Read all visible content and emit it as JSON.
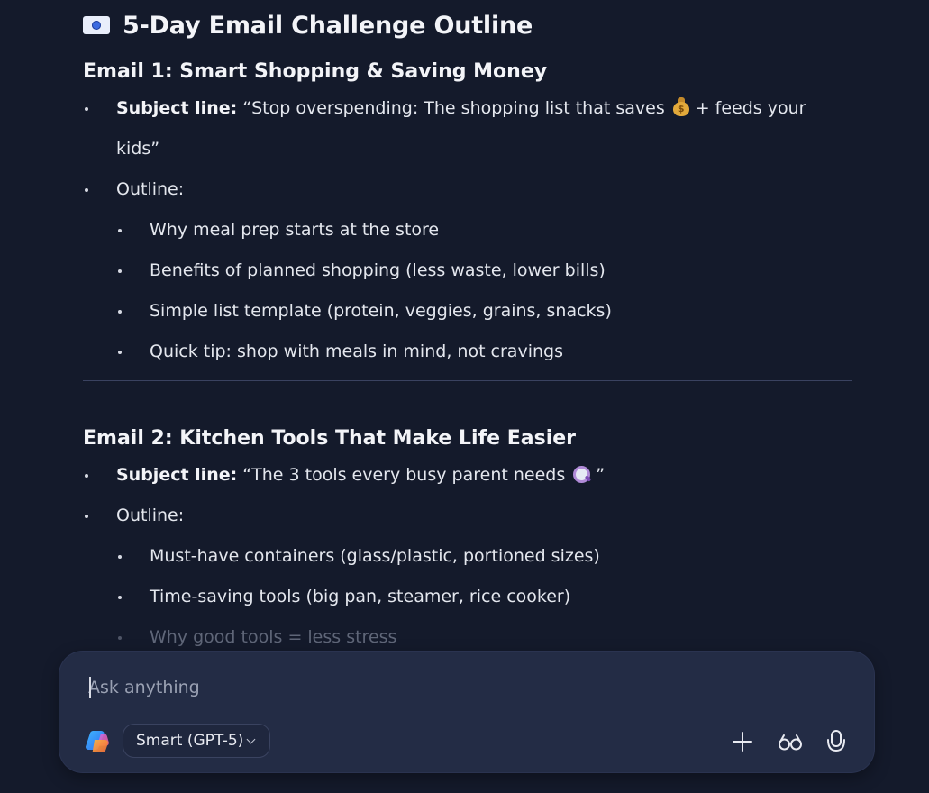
{
  "doc": {
    "title": "5-Day Email Challenge Outline",
    "title_icon": "calendar-icon",
    "emails": [
      {
        "heading": "Email 1: Smart Shopping & Saving Money",
        "subject_label": "Subject line:",
        "subject_pre": "“Stop overspending: The shopping list that saves",
        "subject_emoji": "money-bag-icon",
        "subject_post": "+ feeds your kids”",
        "outline_label": "Outline:",
        "outline_items": [
          "Why meal prep starts at the store",
          "Benefits of planned shopping (less waste, lower bills)",
          "Simple list template (protein, veggies, grains, snacks)",
          "Quick tip: shop with meals in mind, not cravings"
        ]
      },
      {
        "heading": "Email 2: Kitchen Tools That Make Life Easier",
        "subject_label": "Subject line:",
        "subject_pre": "“The 3 tools every busy parent needs",
        "subject_emoji": "magnifying-glass-icon",
        "subject_post": "”",
        "outline_label": "Outline:",
        "outline_items": [
          "Must-have containers (glass/plastic, portioned sizes)",
          "Time-saving tools (big pan, steamer, rice cooker)",
          "Why good tools = less stress"
        ]
      }
    ]
  },
  "composer": {
    "placeholder": "Ask anything",
    "model_label": "Smart (GPT-5)",
    "icons": {
      "logo": "copilot-logo-icon",
      "add": "plus-icon",
      "vision": "glasses-icon",
      "voice": "microphone-icon"
    }
  },
  "colors": {
    "background": "#141a2b",
    "composer_bg": "#232c45",
    "text": "#e4e7ee"
  }
}
